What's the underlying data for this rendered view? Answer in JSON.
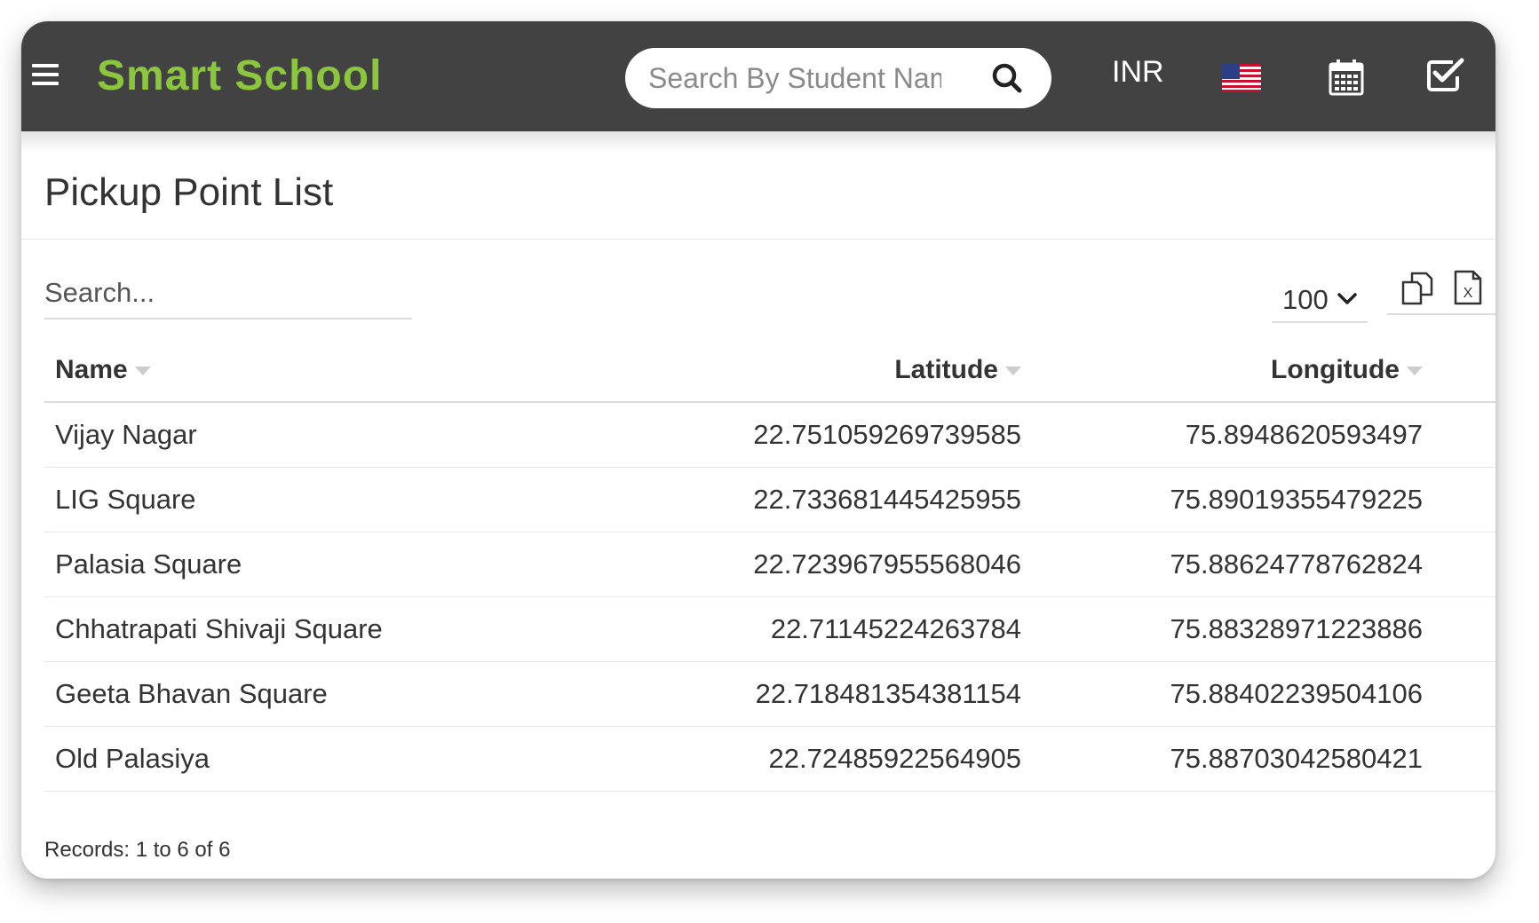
{
  "header": {
    "brand": "Smart School",
    "search_placeholder": "Search By Student Name",
    "currency": "INR",
    "flag": "us-flag-icon"
  },
  "page": {
    "title": "Pickup Point List",
    "search_placeholder": "Search...",
    "page_size": "100"
  },
  "table": {
    "columns": [
      "Name",
      "Latitude",
      "Longitude"
    ],
    "rows": [
      {
        "name": "Vijay Nagar",
        "latitude": "22.751059269739585",
        "longitude": "75.8948620593497"
      },
      {
        "name": "LIG Square",
        "latitude": "22.733681445425955",
        "longitude": "75.89019355479225"
      },
      {
        "name": "Palasia Square",
        "latitude": "22.723967955568046",
        "longitude": "75.88624778762824"
      },
      {
        "name": "Chhatrapati Shivaji Square",
        "latitude": "22.71145224263784",
        "longitude": "75.88328971223886"
      },
      {
        "name": "Geeta Bhavan Square",
        "latitude": "22.718481354381154",
        "longitude": "75.88402239504106"
      },
      {
        "name": "Old Palasiya",
        "latitude": "22.72485922564905",
        "longitude": "75.88703042580421"
      }
    ]
  },
  "footer": {
    "records": "Records: 1 to 6 of 6"
  },
  "colors": {
    "topbar": "#424242",
    "brand": "#8cc63f",
    "text": "#333333"
  }
}
